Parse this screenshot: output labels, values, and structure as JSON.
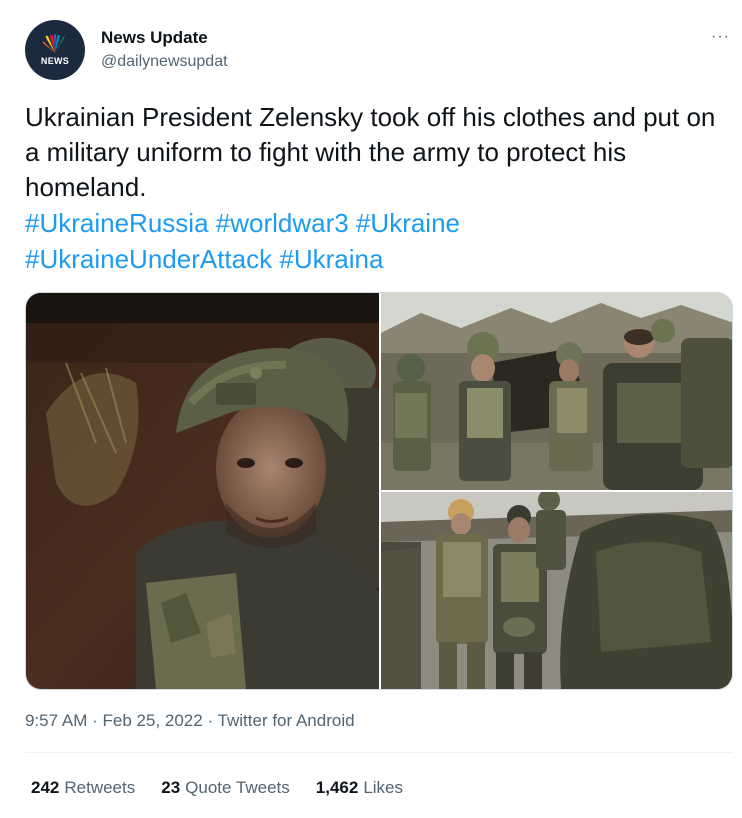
{
  "author": {
    "name": "News Update",
    "handle": "@dailynewsupdat",
    "avatar_label": "NEWS",
    "avatar_icon": "peacock-logo-icon"
  },
  "more_icon": "···",
  "tweet": {
    "text": "Ukrainian President Zelensky took off his clothes and put on a military uniform to fight with the army to protect his homeland.",
    "hashtags": [
      "#UkraineRussia",
      "#worldwar3",
      "#Ukraine",
      "#UkraineUnderAttack",
      "#Ukraina"
    ]
  },
  "media": {
    "photos": [
      {
        "description": "soldier-in-trench-photo"
      },
      {
        "description": "soldiers-at-bunker-photo"
      },
      {
        "description": "soldiers-walking-photo"
      }
    ]
  },
  "meta": {
    "time": "9:57 AM",
    "separator": "·",
    "date": "Feb 25, 2022",
    "source": "Twitter for Android"
  },
  "stats": {
    "retweets_count": "242",
    "retweets_label": "Retweets",
    "quotes_count": "23",
    "quotes_label": "Quote Tweets",
    "likes_count": "1,462",
    "likes_label": "Likes"
  },
  "colors": {
    "link": "#1d9bf0",
    "secondary_text": "#536471",
    "primary_text": "#0f1419",
    "border": "#cfd9de"
  }
}
